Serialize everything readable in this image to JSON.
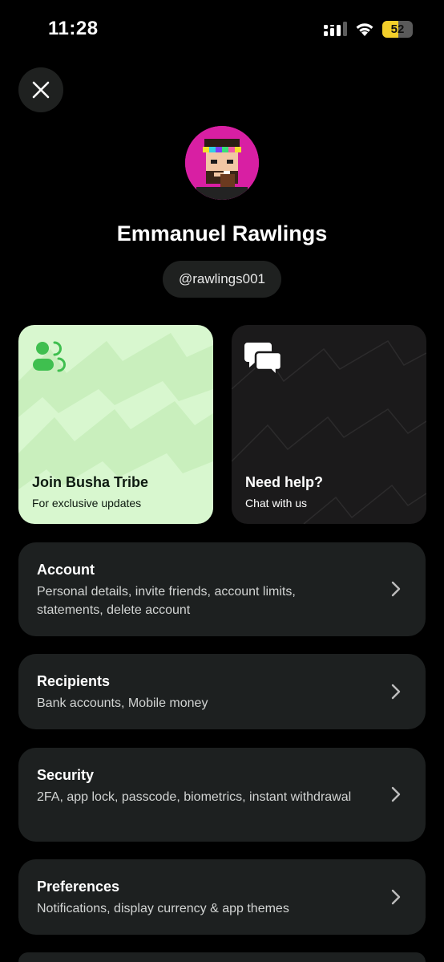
{
  "status_bar": {
    "time": "11:28",
    "battery": "52",
    "battery_level": 0.52
  },
  "profile": {
    "name": "Emmanuel Rawlings",
    "handle": "@rawlings001"
  },
  "cards": [
    {
      "title": "Join Busha Tribe",
      "subtitle": "For exclusive updates",
      "icon": "community-icon",
      "color": "#d8f7cf"
    },
    {
      "title": "Need help?",
      "subtitle": "Chat with us",
      "icon": "chat-bubbles-icon",
      "color": "#1b1a1b"
    }
  ],
  "menu": [
    {
      "title": "Account",
      "desc": "Personal details, invite friends, account limits, statements, delete account"
    },
    {
      "title": "Recipients",
      "desc": "Bank accounts, Mobile money"
    },
    {
      "title": "Security",
      "desc": "2FA, app lock, passcode, biometrics, instant withdrawal"
    },
    {
      "title": "Preferences",
      "desc": "Notifications, display currency & app themes"
    }
  ],
  "colors": {
    "accent_green": "#3fbf4f",
    "avatar_bg": "#d81fa3",
    "battery": "#f3cf2a"
  }
}
